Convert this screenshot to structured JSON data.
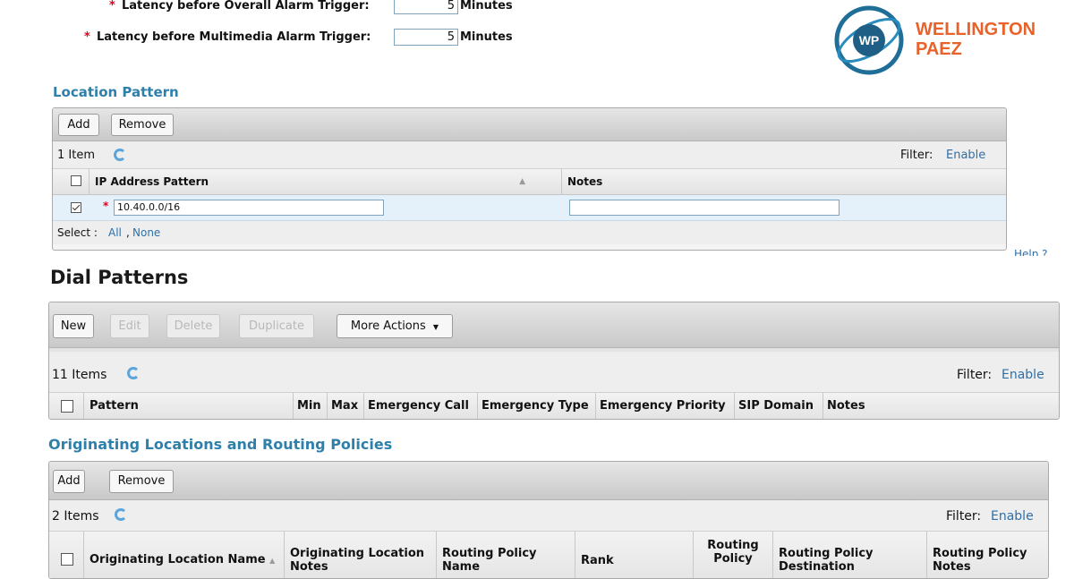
{
  "latency": {
    "overall": {
      "required_marker": "*",
      "label": "Latency before Overall Alarm Trigger:",
      "value": "5",
      "unit": "Minutes"
    },
    "multimedia": {
      "required_marker": "*",
      "label": "Latency before Multimedia Alarm Trigger:",
      "value": "5",
      "unit": "Minutes"
    }
  },
  "watermark": {
    "logo_text": "WP",
    "line1": "WELLINGTON",
    "line2": "PAEZ",
    "brand_color": "#e8622a",
    "ring_color": "#1f6e97"
  },
  "location_pattern": {
    "title": "Location Pattern",
    "buttons": {
      "add": "Add",
      "remove": "Remove"
    },
    "item_count": "1 Item",
    "filter_label": "Filter:",
    "filter_link": "Enable",
    "columns": {
      "ip": "IP Address Pattern",
      "sort_indicator": "▲",
      "notes": "Notes"
    },
    "rows": [
      {
        "required_marker": "*",
        "ip": "10.40.0.0/16",
        "notes": ""
      }
    ],
    "select_label": "Select :",
    "select_all": "All",
    "select_none": "None"
  },
  "help_link": "Help ?",
  "dial_patterns": {
    "title": "Dial Patterns",
    "buttons": {
      "new": "New",
      "edit": "Edit",
      "delete": "Delete",
      "duplicate": "Duplicate",
      "more_actions": "More Actions"
    },
    "dropdown_caret": "▼",
    "item_count": "11 Items",
    "filter_label": "Filter:",
    "filter_link": "Enable",
    "columns": [
      "Pattern",
      "Min",
      "Max",
      "Emergency Call",
      "Emergency Type",
      "Emergency Priority",
      "SIP Domain",
      "Notes"
    ]
  },
  "originating": {
    "title": "Originating Locations and Routing Policies",
    "buttons": {
      "add": "Add",
      "remove": "Remove"
    },
    "item_count": "2 Items",
    "filter_label": "Filter:",
    "filter_link": "Enable",
    "columns": {
      "origin_name": "Originating Location Name",
      "sort_indicator": "▲",
      "origin_notes_l1": "Originating Location",
      "origin_notes_l2": "Notes",
      "rp_name_l1": "Routing Policy",
      "rp_name_l2": "Name",
      "rank": "Rank",
      "rp_disabled_l1": "Routing",
      "rp_disabled_l2": "Policy",
      "rp_dest_l1": "Routing Policy",
      "rp_dest_l2": "Destination",
      "rp_notes_l1": "Routing Policy",
      "rp_notes_l2": "Notes"
    }
  },
  "colors": {
    "section_title": "#2f7fab",
    "link": "#2f6fa8",
    "required": "#e0001b",
    "selected_row": "#e4f0fa"
  }
}
